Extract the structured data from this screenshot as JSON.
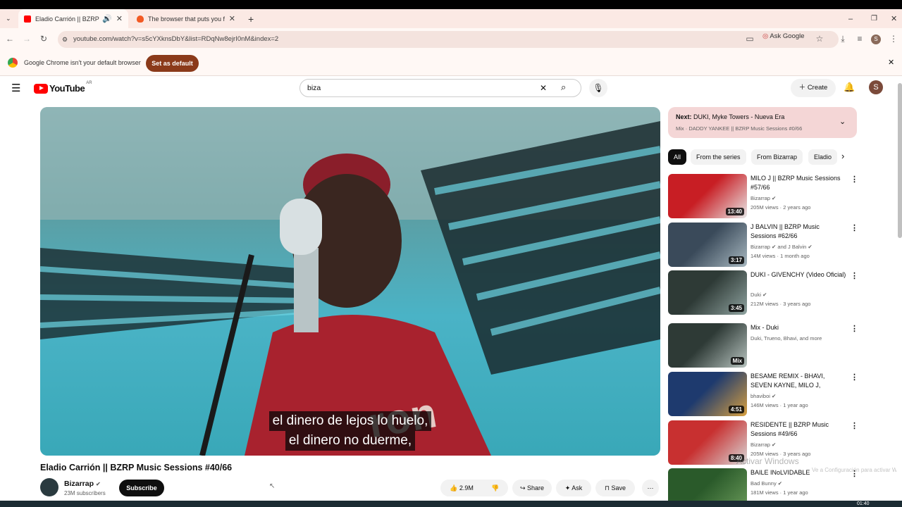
{
  "browser": {
    "tabs": [
      {
        "title": "Eladio Carrión || BZRP Music Sessions #40/66",
        "active": true
      },
      {
        "title": "The browser that puts you first",
        "active": false
      }
    ],
    "url": "youtube.com/watch?v=s5cYXknsDbY&list=RDqNw8ejrI0nM&index=2",
    "ask_google": "Ask Google",
    "profile_initial": "S",
    "infobar_message": "Google Chrome isn't your default browser",
    "set_default_label": "Set as default"
  },
  "youtube": {
    "logo_text": "YouTube",
    "country": "AR",
    "search_value": "biza",
    "create_label": "Create",
    "avatar_initial": "S"
  },
  "video": {
    "subtitle_lines": [
      "el dinero de lejos lo huelo,",
      "el dinero no duerme,"
    ],
    "title": "Eladio Carrión || BZRP Music Sessions #40/66",
    "channel": "Bizarrap",
    "subscribers": "23M subscribers",
    "subscribe_label": "Subscribe",
    "likes": "2.9M",
    "share_label": "Share",
    "ask_label": "Ask",
    "save_label": "Save"
  },
  "playlist": {
    "next_prefix": "Next:",
    "next_title": "DUKI, Myke Towers - Nueva Era",
    "mix_line": "Mix · DADDY YANKEE || BZRP Music Sessions #0/66"
  },
  "chips": [
    "All",
    "From the series",
    "From Bizarrap",
    "Eladio"
  ],
  "recommendations": [
    {
      "title": "MILO J || BZRP Music Sessions #57/66",
      "channel": "Bizarrap",
      "meta": "205M views · 2 years ago",
      "duration": "13:40",
      "colors": [
        "#c81e24",
        "#e8e8e8"
      ]
    },
    {
      "title": "J BALVIN || BZRP Music Sessions #62/66",
      "channel": "Bizarrap",
      "channel_extra": "and J Balvin",
      "meta": "14M views · 1 month ago",
      "duration": "3:17",
      "colors": [
        "#3a4a5a",
        "#a8b8c0"
      ]
    },
    {
      "title": "DUKI - GIVENCHY (Video Oficial)",
      "channel": "Duki",
      "meta": "212M views · 3 years ago",
      "duration": "3:45",
      "colors": [
        "#2e3a36",
        "#8fa3a0"
      ]
    },
    {
      "title": "Mix - Duki",
      "channel": "Duki, Trueno, Bhavi, and more",
      "meta": "",
      "duration": "Mix",
      "colors": [
        "#2e3a36",
        "#b8c4c0"
      ]
    },
    {
      "title": "BESAME REMIX - BHAVI, SEVEN KAYNE, MILO J, TIAGO...",
      "channel": "bhaviboi",
      "meta": "146M views · 1 year ago",
      "duration": "4:51",
      "colors": [
        "#1e3a6e",
        "#d8a040"
      ]
    },
    {
      "title": "RESIDENTE || BZRP Music Sessions #49/66",
      "channel": "Bizarrap",
      "meta": "205M views · 3 years ago",
      "duration": "8:40",
      "colors": [
        "#c83030",
        "#d8d8d8"
      ]
    },
    {
      "title": "BAILE INoLVIDABLE",
      "channel": "Bad Bunny",
      "meta": "181M views · 1 year ago",
      "duration": "",
      "colors": [
        "#2a5a2a",
        "#6a9a5a"
      ]
    }
  ],
  "os": {
    "watermark": "Activar Windows",
    "watermark_sub": "Ve a Configuración para activar Windows.",
    "clock": "01:40"
  }
}
